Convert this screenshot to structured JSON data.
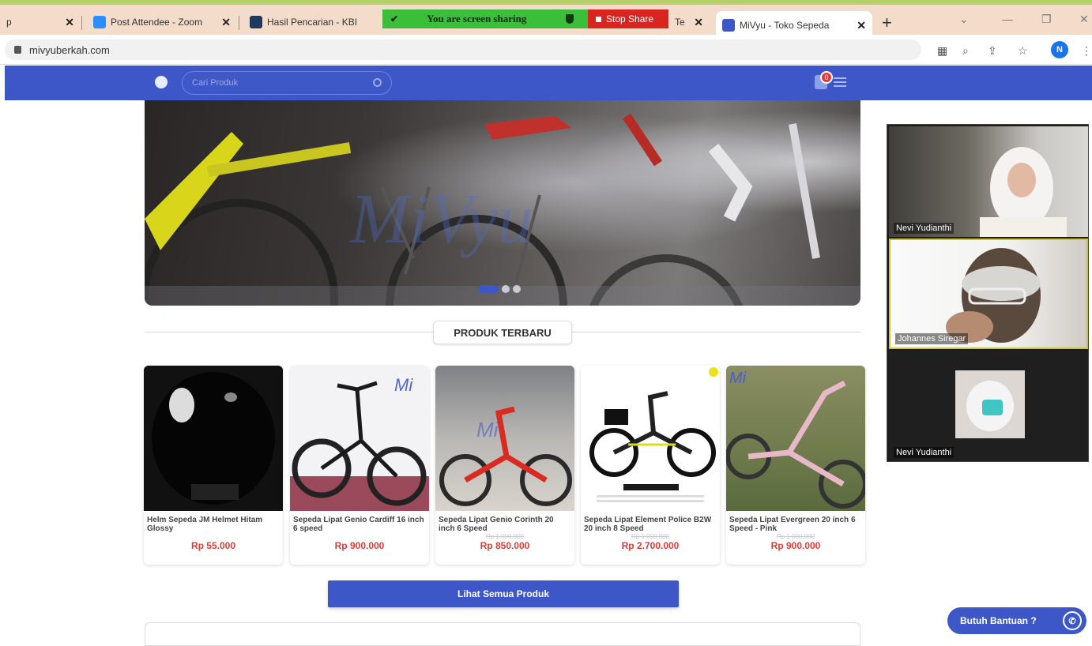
{
  "browser": {
    "tabs": [
      {
        "title": "p",
        "favicon_color": "#f4dccb"
      },
      {
        "title": "Post Attendee - Zoom",
        "favicon_color": "#2d8cff"
      },
      {
        "title": "Hasil Pencarian - KBI",
        "favicon_color": "#1f3a5c"
      },
      {
        "title": "Te",
        "favicon_color": "#e8eaed"
      },
      {
        "title": "MiVyu - Toko Sepeda",
        "favicon_color": "#3d57c9"
      }
    ],
    "new_tab": "+",
    "url": "mivyuberkah.com",
    "profile_initial": "N"
  },
  "screen_share": {
    "status": "You are screen sharing",
    "stop_label": "Stop Share"
  },
  "site": {
    "search_placeholder": "Cari Produk",
    "cart_count": "0",
    "brand_color": "#3d57c9",
    "slider_dots": 3,
    "slider_active": 0,
    "section_title": "PRODUK TERBARU",
    "products": [
      {
        "name": "Helm Sepeda JM Helmet Hitam Glossy",
        "old_price": "",
        "price": "Rp 55.000",
        "image": "black-helmet"
      },
      {
        "name": "Sepeda Lipat Genio Cardiff 16 inch 6 speed",
        "old_price": "",
        "price": "Rp 900.000",
        "image": "black-folding-bike"
      },
      {
        "name": "Sepeda Lipat Genio Corinth 20 inch 6 Speed",
        "old_price": "Rp 1.000.000",
        "price": "Rp 850.000",
        "image": "red-folding-bike"
      },
      {
        "name": "Sepeda Lipat Element Police B2W 20 inch 8 Speed",
        "old_price": "Rp 3.000.000",
        "price": "Rp 2.700.000",
        "image": "black-yellow-folding-bike"
      },
      {
        "name": "Sepeda Lipat Evergreen 20 inch 6 Speed - Pink",
        "old_price": "Rp 1.000.000",
        "price": "Rp 900.000",
        "image": "pink-folding-bike"
      }
    ],
    "view_all_label": "Lihat Semua Produk",
    "help_label": "Butuh Bantuan ?"
  },
  "zoom": {
    "participants": [
      {
        "name": "Nevi Yudianthi",
        "speaking": false
      },
      {
        "name": "Johannes Siregar",
        "speaking": true
      },
      {
        "name": "Nevi Yudianthi",
        "speaking": false
      }
    ]
  }
}
